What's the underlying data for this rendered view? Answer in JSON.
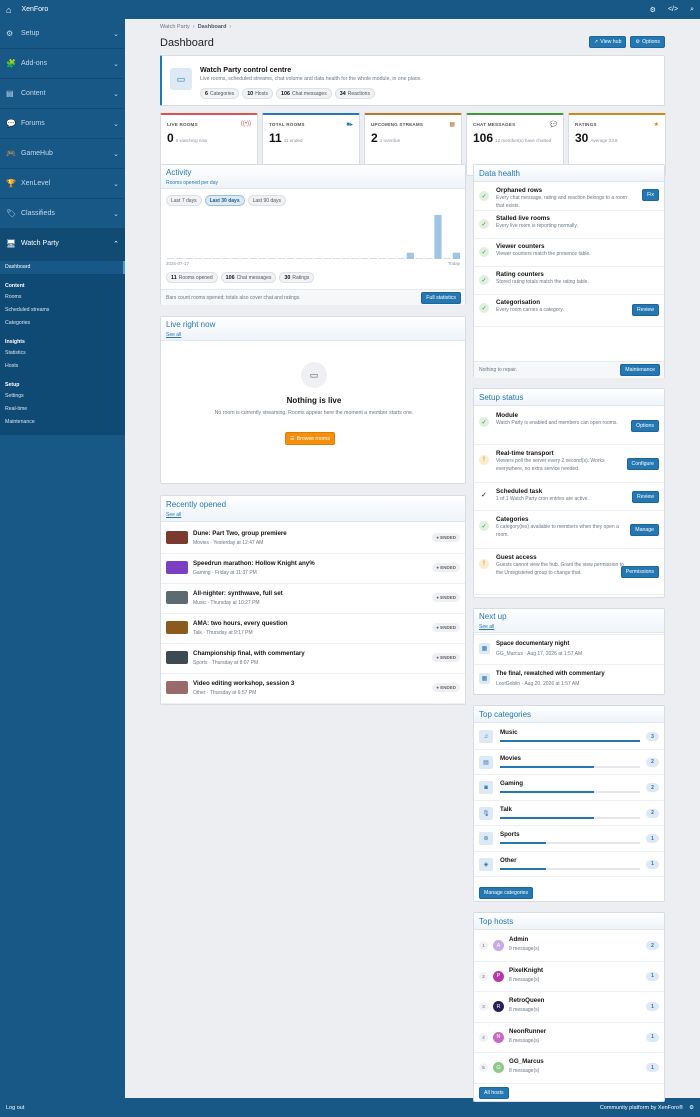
{
  "app": {
    "brand": "XenForo"
  },
  "sidebar": {
    "sections": [
      {
        "icon": "⚙",
        "label": "Setup"
      },
      {
        "icon": "🧩",
        "label": "Add-ons"
      },
      {
        "icon": "▤",
        "label": "Content"
      },
      {
        "icon": "💬",
        "label": "Forums"
      },
      {
        "icon": "🎮",
        "label": "GameHub"
      },
      {
        "icon": "🏆",
        "label": "XenLevel"
      },
      {
        "icon": "🏷",
        "label": "Classifieds"
      },
      {
        "icon": "🖥",
        "label": "Watch Party"
      }
    ],
    "sub": {
      "dashboard": "Dashboard",
      "content_h": "Content",
      "rooms": "Rooms",
      "scheduled": "Scheduled streams",
      "categories": "Categories",
      "insights_h": "Insights",
      "statistics": "Statistics",
      "hosts": "Hosts",
      "setup_h": "Setup",
      "settings": "Settings",
      "realtime": "Real-time",
      "maintenance": "Maintenance"
    },
    "logout": "Log out"
  },
  "footer": {
    "powered": "Community platform by XenForo®"
  },
  "page": {
    "crumb1": "Watch Party",
    "crumb2": "Dashboard",
    "title": "Dashboard",
    "view_hub": "View hub",
    "options": "Options"
  },
  "hero": {
    "title": "Watch Party control centre",
    "subtitle": "Live rooms, scheduled streams, chat volume and data health for the whole module, in one place.",
    "pills": [
      {
        "n": "6",
        "t": "Categories"
      },
      {
        "n": "10",
        "t": "Hosts"
      },
      {
        "n": "106",
        "t": "Chat messages"
      },
      {
        "n": "34",
        "t": "Reactions"
      }
    ]
  },
  "kpis": [
    {
      "label": "LIVE ROOMS",
      "value": "0",
      "sub": "0 watching now",
      "icon": "((•))",
      "color": "#d9534f"
    },
    {
      "label": "TOTAL ROOMS",
      "value": "11",
      "sub": "11 ended",
      "icon": "■▸",
      "color": "#2577b1"
    },
    {
      "label": "UPCOMING STREAMS",
      "value": "2",
      "sub": "1 overdue",
      "icon": "▦",
      "color": "#b5792c"
    },
    {
      "label": "CHAT MESSAGES",
      "value": "106",
      "sub": "12 member(s) have chatted",
      "icon": "💬",
      "color": "#3a9a3a"
    },
    {
      "label": "RATINGS",
      "value": "30",
      "sub": "Average 23.8",
      "icon": "★",
      "color": "#c98a1a"
    }
  ],
  "activity": {
    "title": "Activity",
    "subtitle": "Rooms opened per day",
    "tabs": [
      "Last 7 days",
      "Last 30 days",
      "Last 90 days"
    ],
    "start": "2026-07-17",
    "end": "Today",
    "pills": [
      {
        "n": "11",
        "t": "Rooms opened"
      },
      {
        "n": "106",
        "t": "Chat messages"
      },
      {
        "n": "30",
        "t": "Ratings"
      }
    ],
    "note": "Bars count rooms opened; totals also cover chat and ratings.",
    "button": "Full statistics"
  },
  "chart_data": {
    "type": "bar",
    "x": [
      "2026-07-17",
      "",
      "",
      "",
      "",
      "",
      "",
      "",
      "",
      "",
      "",
      "",
      "",
      "",
      "",
      "",
      "",
      "",
      "",
      "",
      "",
      "",
      "",
      "",
      "",
      "",
      "",
      "",
      "",
      "Today"
    ],
    "values": [
      0,
      0,
      0,
      0,
      0,
      0,
      0,
      0,
      0,
      0,
      0,
      0,
      0,
      0,
      0,
      0,
      0,
      0,
      0,
      0,
      0,
      0,
      0,
      0,
      0,
      0,
      1,
      0,
      0,
      7,
      0,
      1
    ]
  },
  "live": {
    "title": "Live right now",
    "see_all": "See all",
    "empty_title": "Nothing is live",
    "empty_text": "No room is currently streaming. Rooms appear here the moment a member starts one.",
    "button": "Browse rooms"
  },
  "recent": {
    "title": "Recently opened",
    "see_all": "See all",
    "items": [
      {
        "title": "Dune: Part Two, group premiere",
        "meta": "Movies · Yesterday at 12:47 AM",
        "status": "ENDED",
        "thumb": "#7a3b2e"
      },
      {
        "title": "Speedrun marathon: Hollow Knight any%",
        "meta": "Gaming · Friday at 11:37 PM",
        "status": "ENDED",
        "thumb": "#7b3fc4"
      },
      {
        "title": "All-nighter: synthwave, full set",
        "meta": "Music · Thursday at 10:27 PM",
        "status": "ENDED",
        "thumb": "#5b6b6f"
      },
      {
        "title": "AMA: two hours, every question",
        "meta": "Talk · Thursday at 9:17 PM",
        "status": "ENDED",
        "thumb": "#8a5a1e"
      },
      {
        "title": "Championship final, with commentary",
        "meta": "Sports · Thursday at 8:07 PM",
        "status": "ENDED",
        "thumb": "#3c4a52"
      },
      {
        "title": "Video editing workshop, session 3",
        "meta": "Other · Thursday at 6:57 PM",
        "status": "ENDED",
        "thumb": "#9b6a6a"
      }
    ]
  },
  "health": {
    "title": "Data health",
    "items": [
      {
        "title": "Orphaned rows",
        "desc": "Every chat message, rating and reaction belongs to a room that exists.",
        "btn": "Fix"
      },
      {
        "title": "Stalled live rooms",
        "desc": "Every live room is reporting normally.",
        "btn": ""
      },
      {
        "title": "Viewer counters",
        "desc": "Viewer counters match the presence table.",
        "btn": ""
      },
      {
        "title": "Rating counters",
        "desc": "Stored rating totals match the rating table.",
        "btn": ""
      },
      {
        "title": "Categorisation",
        "desc": "Every room carries a category.",
        "btn": "Review"
      }
    ],
    "footer": "Nothing to repair.",
    "button": "Maintenance"
  },
  "setup": {
    "title": "Setup status",
    "items": [
      {
        "title": "Module",
        "desc": "Watch Party is enabled and members can open rooms.",
        "btn": "Options",
        "state": "ok"
      },
      {
        "title": "Real-time transport",
        "desc": "Viewers poll the server every 2 second(s). Works everywhere, no extra service needed.",
        "btn": "Configure",
        "state": "warn"
      },
      {
        "title": "Scheduled task",
        "desc": "1 of 1 Watch Party cron entries are active.",
        "btn": "Review",
        "state": "check"
      },
      {
        "title": "Categories",
        "desc": "6 category(ies) available to members when they open a room.",
        "btn": "Manage",
        "state": "ok"
      },
      {
        "title": "Guest access",
        "desc": "Guests cannot view the hub. Grant the view permission to the Unregistered group to change that.",
        "btn": "Permissions",
        "state": "warn"
      }
    ]
  },
  "nextup": {
    "title": "Next up",
    "see_all": "See all",
    "items": [
      {
        "title": "Space documentary night",
        "meta": "GG_Marcus · Aug 17, 2026 at 1:57 AM"
      },
      {
        "title": "The final, rewatched with commentary",
        "meta": "LootGoblin · Aug 20, 2026 at 1:57 AM"
      }
    ]
  },
  "topcats": {
    "title": "Top categories",
    "button": "Manage categories",
    "items": [
      {
        "name": "Music",
        "count": 3,
        "icon": "♫",
        "frac": 1.0
      },
      {
        "name": "Movies",
        "count": 2,
        "icon": "▤",
        "frac": 0.67
      },
      {
        "name": "Gaming",
        "count": 2,
        "icon": "◙",
        "frac": 0.67
      },
      {
        "name": "Talk",
        "count": 2,
        "icon": "🎙",
        "frac": 0.67
      },
      {
        "name": "Sports",
        "count": 1,
        "icon": "⊛",
        "frac": 0.33
      },
      {
        "name": "Other",
        "count": 1,
        "icon": "◈",
        "frac": 0.33
      }
    ]
  },
  "tophosts": {
    "title": "Top hosts",
    "button": "All hosts",
    "items": [
      {
        "rank": "1",
        "name": "Admin",
        "sub": "9 message(s)",
        "count": "2",
        "initial": "A",
        "color": "#c9a8e8"
      },
      {
        "rank": "2",
        "name": "PixelKnight",
        "sub": "8 message(s)",
        "count": "1",
        "initial": "P",
        "color": "#b53aa8"
      },
      {
        "rank": "3",
        "name": "RetroQueen",
        "sub": "8 message(s)",
        "count": "1",
        "initial": "R",
        "color": "#2a1d5a"
      },
      {
        "rank": "4",
        "name": "NeonRunner",
        "sub": "8 message(s)",
        "count": "1",
        "initial": "N",
        "color": "#c86ac4"
      },
      {
        "rank": "5",
        "name": "GG_Marcus",
        "sub": "8 message(s)",
        "count": "1",
        "initial": "G",
        "color": "#8ec88a"
      }
    ]
  }
}
